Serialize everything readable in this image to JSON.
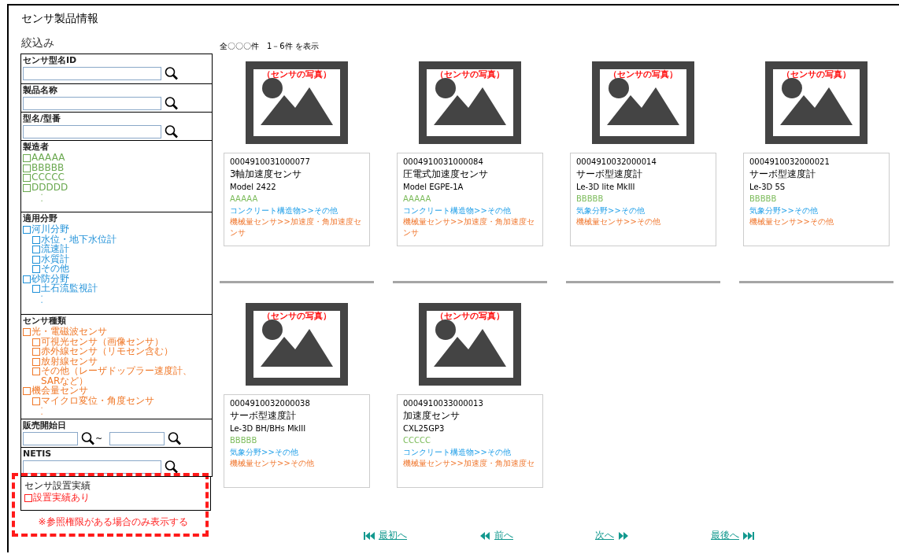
{
  "page_title": "センサ製品情報",
  "filter": {
    "heading": "絞込み",
    "sections": [
      {
        "kind": "text",
        "label": "センサ型名ID"
      },
      {
        "kind": "text",
        "label": "製品名称"
      },
      {
        "kind": "text",
        "label": "型名/型番"
      },
      {
        "kind": "checklist",
        "label": "製造者",
        "color": "#6aa84f",
        "items": [
          {
            "label": "AAAAA",
            "checked": false
          },
          {
            "label": "BBBBB",
            "checked": false
          },
          {
            "label": "CCCCC",
            "checked": false
          },
          {
            "label": "DDDDD",
            "checked": false
          }
        ],
        "more": [
          "・",
          "・"
        ]
      },
      {
        "kind": "checklist",
        "label": "適用分野",
        "color": "#1e90d8",
        "items": [
          {
            "label": "河川分野",
            "checked": false,
            "children": [
              {
                "label": "水位・地下水位計",
                "checked": false
              },
              {
                "label": "流速計",
                "checked": false
              },
              {
                "label": "水質計",
                "checked": false
              },
              {
                "label": "その他",
                "checked": false
              }
            ]
          },
          {
            "label": "砂防分野",
            "checked": false,
            "children": [
              {
                "label": "土石流監視計",
                "checked": false
              }
            ]
          }
        ],
        "more": [
          "・",
          "・"
        ]
      },
      {
        "kind": "checklist",
        "label": "センサ種類",
        "color": "#f07828",
        "items": [
          {
            "label": "光・電磁波センサ",
            "checked": false,
            "children": [
              {
                "label": "可視光センサ（画像センサ）",
                "checked": false
              },
              {
                "label": "赤外線センサ（リモセン含む）",
                "checked": false
              },
              {
                "label": "放射線センサ",
                "checked": false
              },
              {
                "label": "その他（レーザドップラー速度計、SARなど）",
                "checked": false
              }
            ]
          },
          {
            "label": "機会量センサ",
            "checked": false,
            "children": [
              {
                "label": "マイクロ変位・角度センサ",
                "checked": false
              }
            ]
          }
        ],
        "more": [
          "・",
          "・"
        ]
      },
      {
        "kind": "date_range",
        "label": "販売開始日",
        "separator": "~"
      },
      {
        "kind": "text",
        "label": "NETIS"
      }
    ],
    "restricted": {
      "label": "センサ設置実績",
      "color": "#ff2020",
      "items": [
        {
          "label": "設置実績あり",
          "checked": false
        }
      ],
      "note": "※参照権限がある場合のみ表示する"
    }
  },
  "result_count": "全〇〇〇件　1－6件 を表示",
  "products": [
    {
      "photo_label": "（センサの写真）",
      "id": "0004910031000077",
      "name": "3軸加速度センサ",
      "model": "Model 2422",
      "maker": "AAAAA",
      "field": "コンクリート構造物>>その他",
      "type": "機械量センサ>>加速度・角加速度センサ"
    },
    {
      "photo_label": "（センサの写真）",
      "id": "0004910031000084",
      "name": "圧電式加速度センサ",
      "model": "Model EGPE-1A",
      "maker": "AAAAA",
      "field": "コンクリート構造物>>その他",
      "type": "機械量センサ>>加速度・角加速度センサ"
    },
    {
      "photo_label": "（センサの写真）",
      "id": "0004910032000014",
      "name": "サーボ型速度計",
      "model": "Le-3D  lite MkIII",
      "maker": "BBBBB",
      "field": "気象分野>>その他",
      "type": "機械量センサ>>その他"
    },
    {
      "photo_label": "（センサの写真）",
      "id": "0004910032000021",
      "name": "サーボ型速度計",
      "model": "Le-3D 5S",
      "maker": "BBBBB",
      "field": "気象分野>>その他",
      "type": "機械量センサ>>その他"
    },
    {
      "photo_label": "（センサの写真）",
      "id": "0004910032000038",
      "name": "サーボ型速度計",
      "model": "Le-3D BH/BHs MkIII",
      "maker": "BBBBB",
      "field": "気象分野>>その他",
      "type": "機械量センサ>>その他"
    },
    {
      "photo_label": "（センサの写真）",
      "id": "0004910033000013",
      "name": "加速度センサ",
      "model": "CXL25GP3",
      "maker": "CCCCC",
      "field": "コンクリート構造物>>その他",
      "type": "機械量センサ>>加速度・角加速度セ"
    }
  ],
  "pagination": [
    {
      "label": "最初へ",
      "kind": "first"
    },
    {
      "label": "前へ",
      "kind": "prev"
    },
    {
      "label": "次へ",
      "kind": "next"
    },
    {
      "label": "最後へ",
      "kind": "last"
    }
  ]
}
